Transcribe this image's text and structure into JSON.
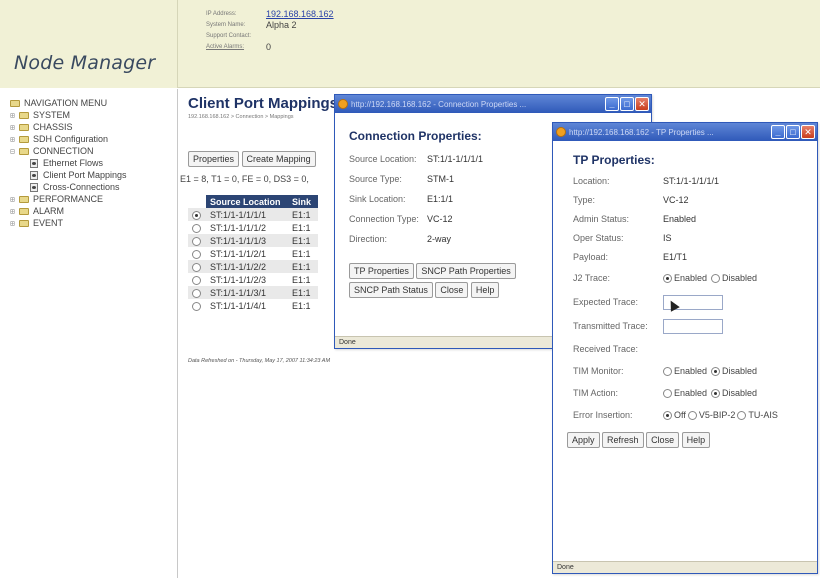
{
  "app": {
    "logo": "Node Manager"
  },
  "header": {
    "rows": [
      {
        "label": "IP Address:",
        "value": "192.168.168.162",
        "link": true
      },
      {
        "label": "System Name:",
        "value": "Alpha 2",
        "link": false
      },
      {
        "label": "Support Contact:",
        "value": "",
        "link": false
      },
      {
        "label": "Active Alarms:",
        "value": "0",
        "link": false
      }
    ]
  },
  "sidebar": {
    "title": "NAVIGATION MENU",
    "items": [
      {
        "label": "SYSTEM"
      },
      {
        "label": "CHASSIS"
      },
      {
        "label": "SDH Configuration"
      },
      {
        "label": "CONNECTION"
      },
      {
        "label": "Ethernet Flows"
      },
      {
        "label": "Client Port Mappings"
      },
      {
        "label": "Cross-Connections"
      },
      {
        "label": "PERFORMANCE"
      },
      {
        "label": "ALARM"
      },
      {
        "label": "EVENT"
      }
    ]
  },
  "main": {
    "title": "Client Port Mappings",
    "breadcrumb": "192.168.168.162 > Connection > Mappings",
    "buttons": {
      "properties": "Properties",
      "create": "Create Mapping"
    },
    "summary": "E1 = 8, T1 = 0, FE = 0, DS3 = 0,",
    "columns": [
      "Source Location",
      "Sink"
    ],
    "rows": [
      {
        "source": "ST:1/1-1/1/1/1",
        "sink": "E1:1"
      },
      {
        "source": "ST:1/1-1/1/1/2",
        "sink": "E1:1"
      },
      {
        "source": "ST:1/1-1/1/1/3",
        "sink": "E1:1"
      },
      {
        "source": "ST:1/1-1/1/2/1",
        "sink": "E1:1"
      },
      {
        "source": "ST:1/1-1/1/2/2",
        "sink": "E1:1"
      },
      {
        "source": "ST:1/1-1/1/2/3",
        "sink": "E1:1"
      },
      {
        "source": "ST:1/1-1/1/3/1",
        "sink": "E1:1"
      },
      {
        "source": "ST:1/1-1/1/4/1",
        "sink": "E1:1"
      }
    ],
    "selected_row": 0,
    "refreshed": "Data Refreshed on - Thursday, May 17, 2007 11:34:23 AM"
  },
  "connection_window": {
    "titlebar": "http://192.168.168.162 - Connection Properties ...",
    "title": "Connection Properties:",
    "props": [
      {
        "label": "Source Location:",
        "value": "ST:1/1-1/1/1/1"
      },
      {
        "label": "Source Type:",
        "value": "STM-1"
      },
      {
        "label": "Sink Location:",
        "value": "E1:1/1"
      },
      {
        "label": "Connection Type:",
        "value": "VC-12"
      },
      {
        "label": "Direction:",
        "value": "2-way"
      }
    ],
    "buttons": {
      "tp": "TP Properties",
      "snc_props": "SNCP Path Properties",
      "snc_status": "SNCP Path Status",
      "close": "Close",
      "help": "Help"
    },
    "status": "Done"
  },
  "tp_window": {
    "titlebar": "http://192.168.168.162 - TP Properties ...",
    "title": "TP Properties:",
    "location": {
      "label": "Location:",
      "value": "ST:1/1-1/1/1/1"
    },
    "type": {
      "label": "Type:",
      "value": "VC-12"
    },
    "admin": {
      "label": "Admin Status:",
      "value": "Enabled"
    },
    "oper": {
      "label": "Oper Status:",
      "value": "IS"
    },
    "payload": {
      "label": "Payload:",
      "value": "E1/T1"
    },
    "j2": {
      "label": "J2 Trace:",
      "opt1": "Enabled",
      "opt2": "Disabled"
    },
    "expected": {
      "label": "Expected Trace:"
    },
    "transmitted": {
      "label": "Transmitted Trace:"
    },
    "received": {
      "label": "Received Trace:"
    },
    "tim_monitor": {
      "label": "TIM Monitor:",
      "opt1": "Enabled",
      "opt2": "Disabled"
    },
    "tim_action": {
      "label": "TIM Action:",
      "opt1": "Enabled",
      "opt2": "Disabled"
    },
    "error": {
      "label": "Error Insertion:",
      "opt1": "Off",
      "opt2": "V5-BIP-2",
      "opt3": "TU-AIS"
    },
    "buttons": {
      "apply": "Apply",
      "refresh": "Refresh",
      "close": "Close",
      "help": "Help"
    },
    "status": "Done"
  }
}
